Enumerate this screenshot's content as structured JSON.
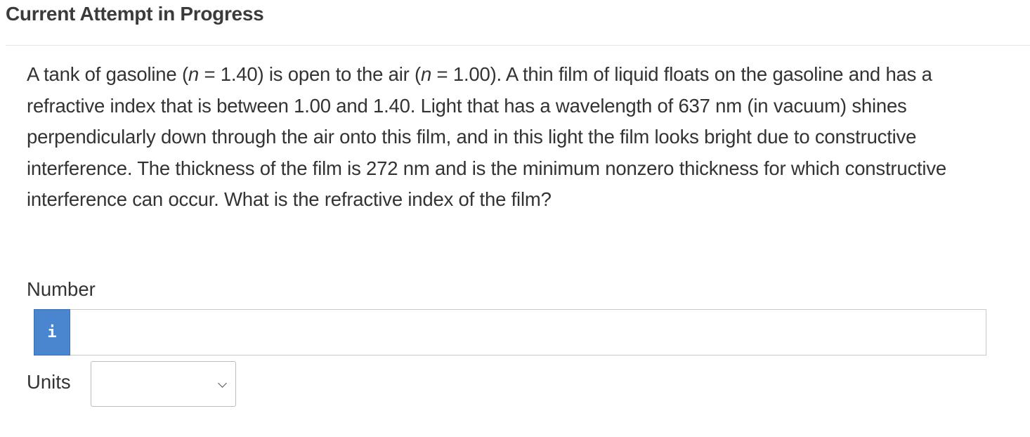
{
  "header": {
    "title": "Current Attempt in Progress"
  },
  "question": {
    "p1": "A tank of gasoline (",
    "var1": "n",
    "p2": " = 1.40) is open to the air (",
    "var2": "n",
    "p3": " = 1.00). A thin film of liquid floats on the gasoline and has a refractive index that is between 1.00 and 1.40. Light that has a wavelength of 637 nm (in vacuum) shines perpendicularly down through the air onto this film, and in this light the film looks bright due to constructive interference. The thickness of the film is 272 nm and is the minimum nonzero thickness for which constructive interference can occur. What is the refractive index of the film?"
  },
  "answer": {
    "number_label": "Number",
    "info_icon_glyph": "i",
    "number_value": "",
    "units_label": "Units",
    "units_selected": ""
  },
  "colors": {
    "info_button": "#4a86d0",
    "text": "#333333"
  }
}
